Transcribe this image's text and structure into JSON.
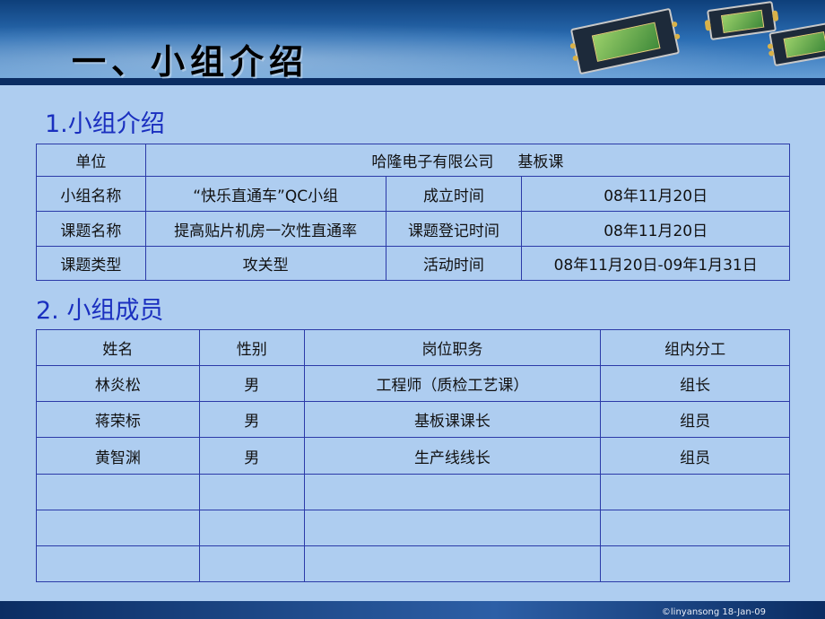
{
  "slide_title": "一、小组介绍",
  "section1_title": "1.小组介绍",
  "info_table": {
    "unit_label": "单位",
    "unit_value": "哈隆电子有限公司     基板课",
    "rows": [
      [
        "小组名称",
        "“快乐直通车”QC小组",
        "成立时间",
        "08年11月20日"
      ],
      [
        "课题名称",
        "提高贴片机房一次性直通率",
        "课题登记时间",
        "08年11月20日"
      ],
      [
        "课题类型",
        "攻关型",
        "活动时间",
        "08年11月20日-09年1月31日"
      ]
    ]
  },
  "section2_title": "2. 小组成员",
  "members_table": {
    "headers": [
      "姓名",
      "性别",
      "岗位职务",
      "组内分工"
    ],
    "rows": [
      [
        "林炎松",
        "男",
        "工程师（质检工艺课）",
        "组长"
      ],
      [
        "蒋荣标",
        "男",
        "基板课课长",
        "组员"
      ],
      [
        "黄智渊",
        "男",
        "生产线线长",
        "组员"
      ]
    ]
  },
  "footer_text": "©linyansong 18-Jan-09"
}
